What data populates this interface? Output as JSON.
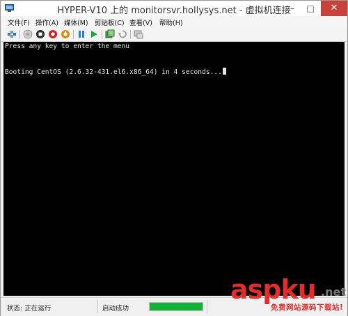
{
  "window": {
    "title": "HYPER-V10 上的 monitorsvr.hollysys.net - 虚拟机连接",
    "controls": {
      "minimize": "–",
      "maximize": "□",
      "close": "✕"
    }
  },
  "menu": [
    {
      "label": "文件(F)"
    },
    {
      "label": "操作(A)"
    },
    {
      "label": "媒体(M)"
    },
    {
      "label": "剪贴板(C)"
    },
    {
      "label": "查看(V)"
    },
    {
      "label": "帮助(H)"
    }
  ],
  "toolbar": {
    "icons": [
      "ctrl-alt-del-icon",
      "start-icon",
      "turn-off-icon",
      "shut-down-icon",
      "save-icon",
      "pause-icon",
      "resume-icon",
      "snapshot-icon",
      "revert-icon",
      "enhanced-session-icon"
    ]
  },
  "console": {
    "lines": [
      "Press any key to enter the menu",
      "Booting CentOS (2.6.32-431.el6.x86_64) in 4 seconds..."
    ]
  },
  "status": {
    "state": "状态: 正在运行",
    "message": "启动成功",
    "progress": 1.0,
    "progress_color": "#14b038"
  },
  "watermark": {
    "logo_a": "asp",
    "logo_b": "ku",
    "logo_c": ".net",
    "sub": "免费网站源码下载站!"
  }
}
